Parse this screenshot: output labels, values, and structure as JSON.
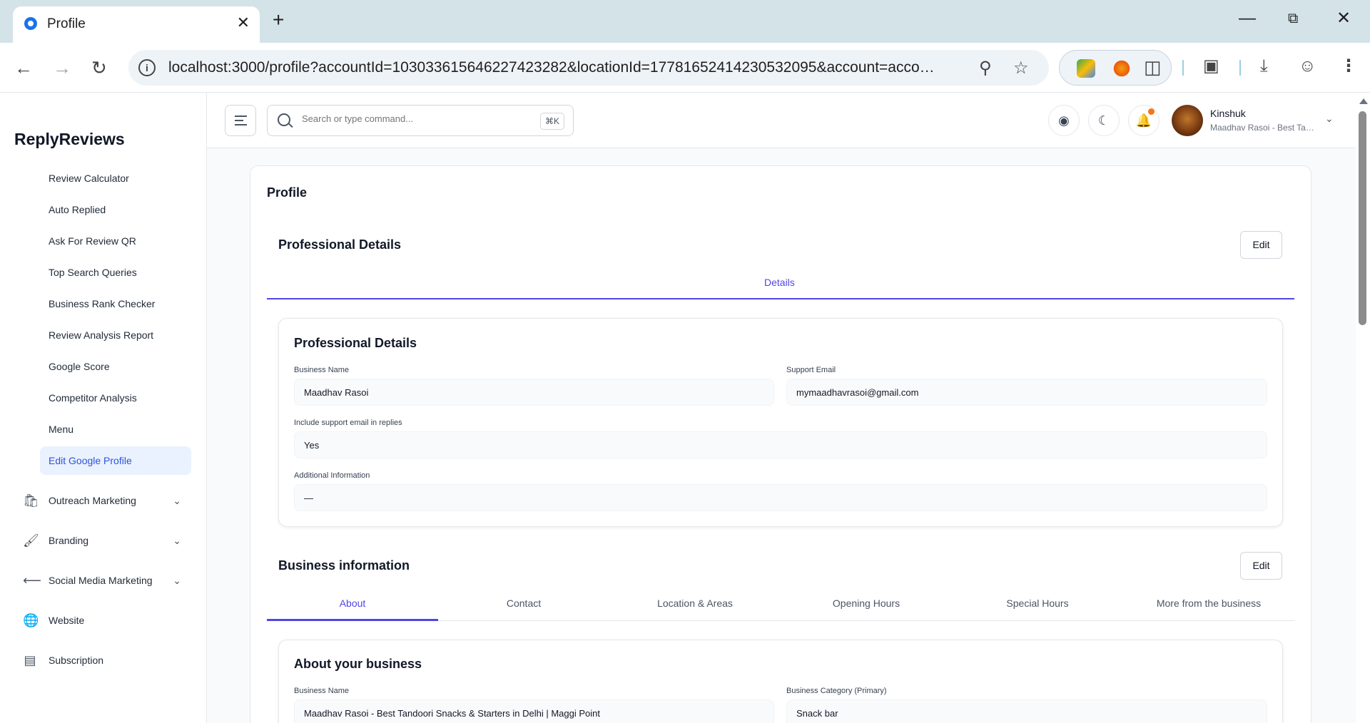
{
  "browser": {
    "tab_title": "Profile",
    "url": "localhost:3000/profile?accountId=103033615646227423282&locationId=17781652414230532095&account=accounts...",
    "new_tab": "+",
    "close_tab": "✕"
  },
  "app": {
    "brand": "ReplyReviews",
    "search": {
      "placeholder": "Search or type command...",
      "shortcut": "⌘K"
    },
    "user": {
      "name": "Kinshuk",
      "subtitle": "Maadhav Rasoi - Best Tandoori Snacks & Starters in Delhi | Maggi Point"
    }
  },
  "sidebar": {
    "sub_items": [
      {
        "label": "Review Calculator"
      },
      {
        "label": "Auto Replied"
      },
      {
        "label": "Ask For Review QR"
      },
      {
        "label": "Top Search Queries"
      },
      {
        "label": "Business Rank Checker"
      },
      {
        "label": "Review Analysis Report"
      },
      {
        "label": "Google Score"
      },
      {
        "label": "Competitor Analysis"
      },
      {
        "label": "Menu"
      },
      {
        "label": "Edit Google Profile",
        "active": true
      }
    ],
    "groups": [
      {
        "label": "Outreach Marketing",
        "icon": "shopping-bag-icon",
        "expandable": true
      },
      {
        "label": "Branding",
        "icon": "paint-brush-icon",
        "expandable": true
      },
      {
        "label": "Social Media Marketing",
        "icon": "share-icon",
        "expandable": true
      },
      {
        "label": "Website",
        "icon": "globe-icon",
        "expandable": false
      },
      {
        "label": "Subscription",
        "icon": "list-icon",
        "expandable": false
      }
    ]
  },
  "page": {
    "title": "Profile",
    "professional": {
      "title": "Professional Details",
      "edit_label": "Edit",
      "tab": "Details",
      "card_title": "Professional Details",
      "fields": {
        "business_name": {
          "label": "Business Name",
          "value": "Maadhav Rasoi"
        },
        "support_email": {
          "label": "Support Email",
          "value": "mymaadhavrasoi@gmail.com"
        },
        "include_email": {
          "label": "Include support email in replies",
          "value": "Yes"
        },
        "additional_info": {
          "label": "Additional Information",
          "value": "—"
        }
      }
    },
    "business": {
      "title": "Business information",
      "edit_label": "Edit",
      "tabs": [
        "About",
        "Contact",
        "Location & Areas",
        "Opening Hours",
        "Special Hours",
        "More from the business"
      ],
      "active_tab": "About",
      "card_title": "About your business",
      "fields": {
        "business_name": {
          "label": "Business Name",
          "value": "Maadhav Rasoi - Best Tandoori Snacks & Starters in Delhi | Maggi Point"
        },
        "category": {
          "label": "Business Category (Primary)",
          "value": "Snack bar"
        }
      }
    }
  },
  "colors": {
    "accent": "#4f46e5",
    "active_bg": "#eaf1ff",
    "notification": "#f97316"
  }
}
